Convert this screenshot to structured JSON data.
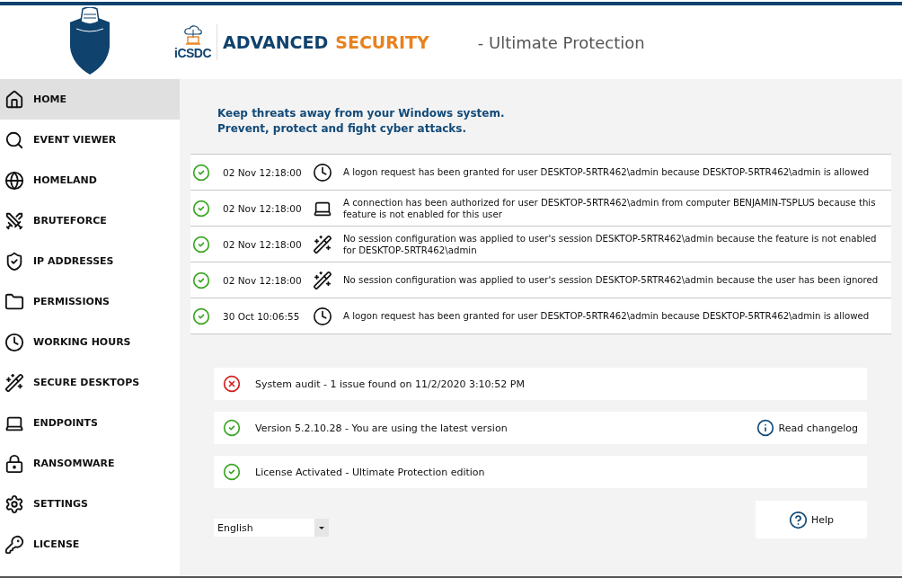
{
  "header": {
    "logo_text": "iCSDC",
    "title_part_1": "ADVANCED",
    "title_part_2": "SECURITY",
    "subtitle": "- Ultimate Protection"
  },
  "sidebar": {
    "items": [
      {
        "label": "HOME",
        "selected": true
      },
      {
        "label": "EVENT VIEWER",
        "selected": false
      },
      {
        "label": "HOMELAND",
        "selected": false
      },
      {
        "label": "BRUTEFORCE",
        "selected": false
      },
      {
        "label": "IP ADDRESSES",
        "selected": false
      },
      {
        "label": "PERMISSIONS",
        "selected": false
      },
      {
        "label": "WORKING HOURS",
        "selected": false
      },
      {
        "label": "SECURE DESKTOPS",
        "selected": false
      },
      {
        "label": "ENDPOINTS",
        "selected": false
      },
      {
        "label": "RANSOMWARE",
        "selected": false
      },
      {
        "label": "SETTINGS",
        "selected": false
      },
      {
        "label": "LICENSE",
        "selected": false
      }
    ]
  },
  "intro": [
    "Keep threats away from your Windows system.",
    "Prevent, protect and fight cyber attacks."
  ],
  "events": [
    {
      "ok": true,
      "time": "02 Nov 12:18:00",
      "kind": "logon",
      "message": "A logon request has been granted for user DESKTOP-5RTR462\\admin because DESKTOP-5RTR462\\admin is allowed"
    },
    {
      "ok": true,
      "time": "02 Nov 12:18:00",
      "kind": "endpoint",
      "message": "A connection has been authorized for user DESKTOP-5RTR462\\admin from computer BENJAMIN-TSPLUS because this feature is not enabled for this user"
    },
    {
      "ok": true,
      "time": "02 Nov 12:18:00",
      "kind": "session",
      "message": "No session configuration was applied to user's session DESKTOP-5RTR462\\admin because the feature is not enabled for DESKTOP-5RTR462\\admin"
    },
    {
      "ok": true,
      "time": "02 Nov 12:18:00",
      "kind": "session",
      "message": "No session configuration was applied to user's session DESKTOP-5RTR462\\admin because the user has been ignored"
    },
    {
      "ok": true,
      "time": "30 Oct 10:06:55",
      "kind": "logon",
      "message": "A logon request has been granted for user DESKTOP-5RTR462\\admin because DESKTOP-5RTR462\\admin is allowed"
    }
  ],
  "status_cards": [
    {
      "ok": false,
      "text": "System audit - 1 issue found on 11/2/2020 3:10:52 PM"
    },
    {
      "ok": true,
      "text": "Version 5.2.10.28 - You are using the latest version",
      "link": "Read changelog"
    },
    {
      "ok": true,
      "text": "License Activated - Ultimate Protection edition"
    }
  ],
  "language": {
    "value": "English"
  },
  "help_button": "Help"
}
